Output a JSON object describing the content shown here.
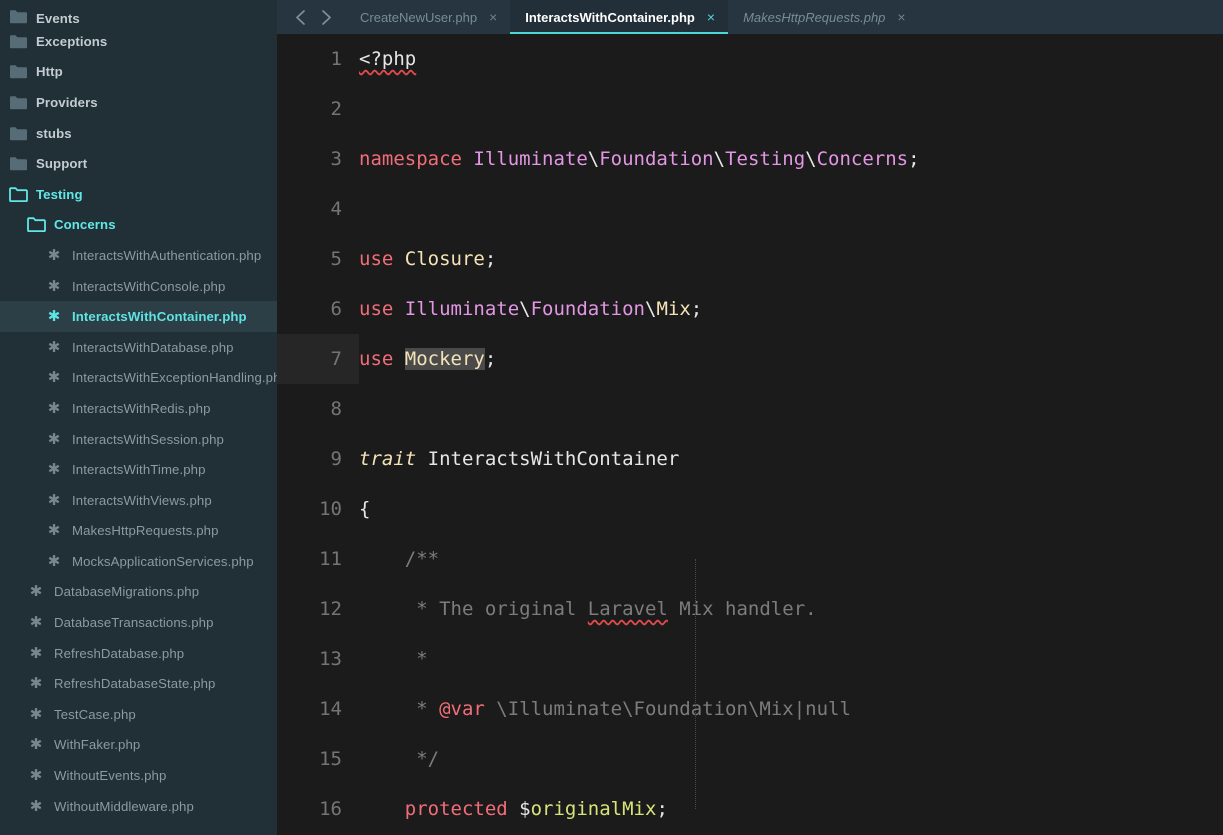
{
  "sidebar": {
    "items": [
      {
        "label": "Events",
        "kind": "folder",
        "depth": 0,
        "open": false,
        "selected": false,
        "partial": true
      },
      {
        "label": "Exceptions",
        "kind": "folder",
        "depth": 0,
        "open": false,
        "selected": false
      },
      {
        "label": "Http",
        "kind": "folder",
        "depth": 0,
        "open": false,
        "selected": false
      },
      {
        "label": "Providers",
        "kind": "folder",
        "depth": 0,
        "open": false,
        "selected": false
      },
      {
        "label": "stubs",
        "kind": "folder",
        "depth": 0,
        "open": false,
        "selected": false
      },
      {
        "label": "Support",
        "kind": "folder",
        "depth": 0,
        "open": false,
        "selected": false
      },
      {
        "label": "Testing",
        "kind": "folder",
        "depth": 0,
        "open": true,
        "selected": false
      },
      {
        "label": "Concerns",
        "kind": "folder",
        "depth": 1,
        "open": true,
        "selected": false
      },
      {
        "label": "InteractsWithAuthentication.php",
        "kind": "file",
        "depth": 2,
        "selected": false
      },
      {
        "label": "InteractsWithConsole.php",
        "kind": "file",
        "depth": 2,
        "selected": false
      },
      {
        "label": "InteractsWithContainer.php",
        "kind": "file",
        "depth": 2,
        "selected": true
      },
      {
        "label": "InteractsWithDatabase.php",
        "kind": "file",
        "depth": 2,
        "selected": false
      },
      {
        "label": "InteractsWithExceptionHandling.php",
        "kind": "file",
        "depth": 2,
        "selected": false
      },
      {
        "label": "InteractsWithRedis.php",
        "kind": "file",
        "depth": 2,
        "selected": false
      },
      {
        "label": "InteractsWithSession.php",
        "kind": "file",
        "depth": 2,
        "selected": false
      },
      {
        "label": "InteractsWithTime.php",
        "kind": "file",
        "depth": 2,
        "selected": false
      },
      {
        "label": "InteractsWithViews.php",
        "kind": "file",
        "depth": 2,
        "selected": false
      },
      {
        "label": "MakesHttpRequests.php",
        "kind": "file",
        "depth": 2,
        "selected": false
      },
      {
        "label": "MocksApplicationServices.php",
        "kind": "file",
        "depth": 2,
        "selected": false
      },
      {
        "label": "DatabaseMigrations.php",
        "kind": "file",
        "depth": 1,
        "selected": false
      },
      {
        "label": "DatabaseTransactions.php",
        "kind": "file",
        "depth": 1,
        "selected": false
      },
      {
        "label": "RefreshDatabase.php",
        "kind": "file",
        "depth": 1,
        "selected": false
      },
      {
        "label": "RefreshDatabaseState.php",
        "kind": "file",
        "depth": 1,
        "selected": false
      },
      {
        "label": "TestCase.php",
        "kind": "file",
        "depth": 1,
        "selected": false
      },
      {
        "label": "WithFaker.php",
        "kind": "file",
        "depth": 1,
        "selected": false
      },
      {
        "label": "WithoutEvents.php",
        "kind": "file",
        "depth": 1,
        "selected": false
      },
      {
        "label": "WithoutMiddleware.php",
        "kind": "file",
        "depth": 1,
        "selected": false
      }
    ]
  },
  "tabbar": {
    "back_icon": "chevron-left-icon",
    "forward_icon": "chevron-right-icon",
    "close_glyph": "×",
    "tabs": [
      {
        "label": "CreateNewUser.php",
        "active": false,
        "preview": false
      },
      {
        "label": "InteractsWithContainer.php",
        "active": true,
        "preview": false
      },
      {
        "label": "MakesHttpRequests.php",
        "active": false,
        "preview": true
      }
    ]
  },
  "editor": {
    "active_line": 7,
    "selection_text": "Mockery",
    "lines": [
      {
        "n": "1",
        "tokens": [
          {
            "t": "<?php",
            "c": "plain squig"
          }
        ]
      },
      {
        "n": "2",
        "tokens": []
      },
      {
        "n": "3",
        "tokens": [
          {
            "t": "namespace ",
            "c": "kw"
          },
          {
            "t": "Illuminate",
            "c": "ns"
          },
          {
            "t": "\\",
            "c": "plain"
          },
          {
            "t": "Foundation",
            "c": "ns"
          },
          {
            "t": "\\",
            "c": "plain"
          },
          {
            "t": "Testing",
            "c": "ns"
          },
          {
            "t": "\\",
            "c": "plain"
          },
          {
            "t": "Concerns",
            "c": "ns"
          },
          {
            "t": ";",
            "c": "plain"
          }
        ]
      },
      {
        "n": "4",
        "tokens": []
      },
      {
        "n": "5",
        "tokens": [
          {
            "t": "use ",
            "c": "kw"
          },
          {
            "t": "Closure",
            "c": "cls"
          },
          {
            "t": ";",
            "c": "plain"
          }
        ]
      },
      {
        "n": "6",
        "tokens": [
          {
            "t": "use ",
            "c": "kw"
          },
          {
            "t": "Illuminate",
            "c": "ns"
          },
          {
            "t": "\\",
            "c": "plain"
          },
          {
            "t": "Foundation",
            "c": "ns"
          },
          {
            "t": "\\",
            "c": "plain"
          },
          {
            "t": "Mix",
            "c": "cls"
          },
          {
            "t": ";",
            "c": "plain"
          }
        ]
      },
      {
        "n": "7",
        "tokens": [
          {
            "t": "use ",
            "c": "kw"
          },
          {
            "t": "Mockery",
            "c": "cls sel"
          },
          {
            "t": ";",
            "c": "plain"
          }
        ]
      },
      {
        "n": "8",
        "tokens": []
      },
      {
        "n": "9",
        "tokens": [
          {
            "t": "trait ",
            "c": "cls it"
          },
          {
            "t": "InteractsWithContainer",
            "c": "plain"
          }
        ]
      },
      {
        "n": "10",
        "tokens": [
          {
            "t": "{",
            "c": "plain"
          }
        ]
      },
      {
        "n": "11",
        "tokens": [
          {
            "t": "    /**",
            "c": "cmt"
          }
        ]
      },
      {
        "n": "12",
        "tokens": [
          {
            "t": "     * The original ",
            "c": "cmt"
          },
          {
            "t": "Laravel",
            "c": "cmt squig"
          },
          {
            "t": " Mix handler.",
            "c": "cmt"
          }
        ]
      },
      {
        "n": "13",
        "tokens": [
          {
            "t": "     *",
            "c": "cmt"
          }
        ]
      },
      {
        "n": "14",
        "tokens": [
          {
            "t": "     * ",
            "c": "cmt"
          },
          {
            "t": "@var",
            "c": "tag"
          },
          {
            "t": " \\Illuminate\\Foundation\\Mix|null",
            "c": "cmt"
          }
        ]
      },
      {
        "n": "15",
        "tokens": [
          {
            "t": "     */",
            "c": "cmt"
          }
        ]
      },
      {
        "n": "16",
        "tokens": [
          {
            "t": "    ",
            "c": "plain"
          },
          {
            "t": "protected ",
            "c": "kw"
          },
          {
            "t": "$",
            "c": "plain"
          },
          {
            "t": "originalMix",
            "c": "var"
          },
          {
            "t": ";",
            "c": "plain"
          }
        ]
      }
    ]
  },
  "colors": {
    "sidebar_bg": "#212f36",
    "editor_bg": "#1b1b1b",
    "tabbar_bg": "#273540",
    "accent": "#4fd6d6",
    "keyword": "#f26d78",
    "namespace": "#e396e3",
    "class": "#f4e3b6",
    "variable": "#d8e37a",
    "comment": "#7c7c7c",
    "error_underline": "#e04a4a"
  }
}
